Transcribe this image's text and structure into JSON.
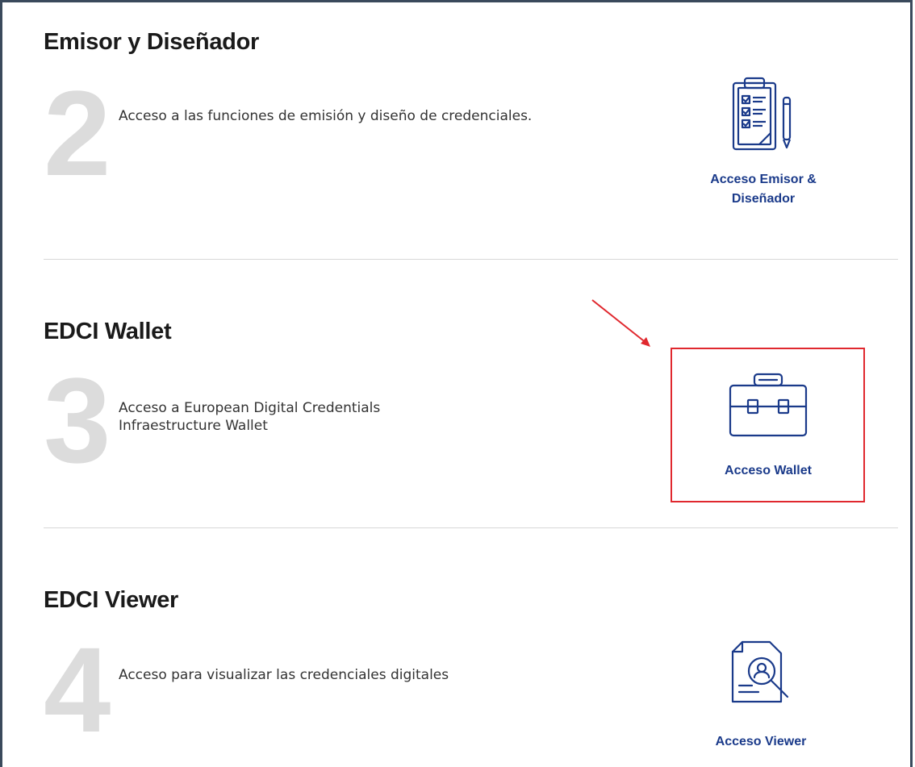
{
  "sections": [
    {
      "title": "Emisor y Diseñador",
      "number": "2",
      "description": "Acceso a las funciones de emisión y diseño de credenciales.",
      "card_label_line1": "Acceso Emisor &",
      "card_label_line2": "Diseñador",
      "icon": "clipboard-checklist-icon"
    },
    {
      "title": "EDCI Wallet",
      "number": "3",
      "description_line1": "Acceso a European Digital Credentials",
      "description_line2": "Infraestructure Wallet",
      "card_label": "Acceso Wallet",
      "icon": "briefcase-icon"
    },
    {
      "title": "EDCI Viewer",
      "number": "4",
      "description": "Acceso para visualizar las credenciales digitales",
      "card_label": "Acceso Viewer",
      "icon": "document-search-icon"
    }
  ],
  "colors": {
    "accent": "#1a3a8a",
    "highlight": "#e0282e",
    "number_gray": "#dcdcdc"
  }
}
